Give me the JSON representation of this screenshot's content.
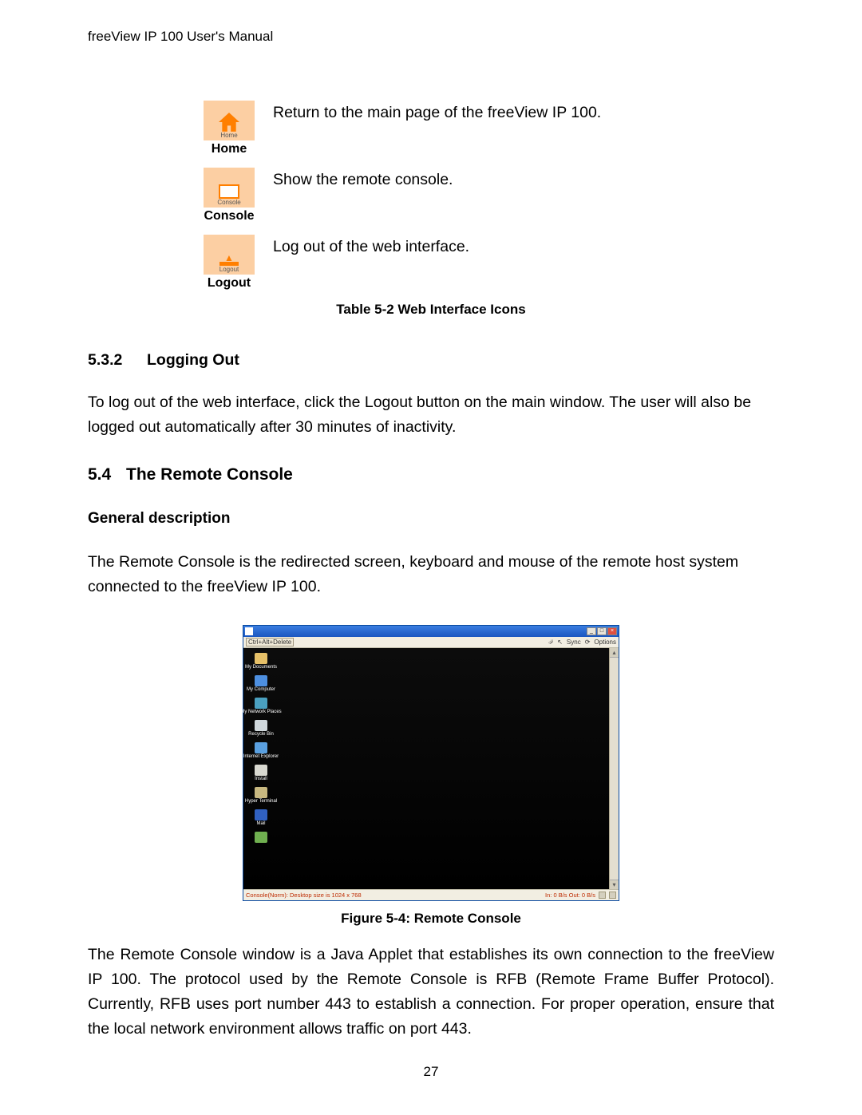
{
  "header": "freeView IP 100 User's Manual",
  "icons_table": {
    "rows": [
      {
        "tiny_label": "Home",
        "bold_label": "Home",
        "description": " Return to the main page of the freeView IP 100."
      },
      {
        "tiny_label": "Console",
        "bold_label": "Console",
        "description": "Show the remote console."
      },
      {
        "tiny_label": "Logout",
        "bold_label": "Logout",
        "description": "Log out of the web interface."
      }
    ],
    "caption": "Table 5-2 Web Interface Icons"
  },
  "section_5_3_2": {
    "number": "5.3.2",
    "title": "Logging Out",
    "body": "To log out of the web interface, click the Logout button on the main window. The user will also be logged out automatically after 30 minutes of inactivity."
  },
  "section_5_4": {
    "number": "5.4",
    "title": "The Remote Console",
    "subheading": "General description",
    "body1": "The Remote Console is the redirected screen, keyboard and mouse of the remote host system connected to the freeView IP 100.",
    "figure": {
      "caption": "Figure 5-4: Remote Console",
      "toolbar_left": "Ctrl+Alt+Delete",
      "toolbar_right": [
        "Sync",
        "Options"
      ],
      "desktop_icons": [
        {
          "label": "My Documents",
          "color": "#e6c068"
        },
        {
          "label": "My Computer",
          "color": "#4d8fe0"
        },
        {
          "label": "My Network Places",
          "color": "#4aa0c0"
        },
        {
          "label": "Recycle Bin",
          "color": "#d0d8dc"
        },
        {
          "label": "Internet Explorer",
          "color": "#5aa0e0"
        },
        {
          "label": "Install",
          "color": "#d8d8d0"
        },
        {
          "label": "Hyper Terminal",
          "color": "#c8b880"
        },
        {
          "label": "Mail",
          "color": "#3060c0"
        },
        {
          "label": "",
          "color": "#70b050"
        }
      ],
      "status_left": "Console(Norm): Desktop size is 1024 x 768",
      "status_right": "In: 0 B/s Out: 0 B/s"
    },
    "body2": "The Remote Console window is a Java Applet that establishes its own connection to the freeView IP 100. The protocol used by the Remote Console is RFB (Remote Frame Buffer Protocol). Currently, RFB uses port number 443 to establish a connection. For proper operation, ensure that the local network environment allows traffic on port 443."
  },
  "page_number": "27"
}
